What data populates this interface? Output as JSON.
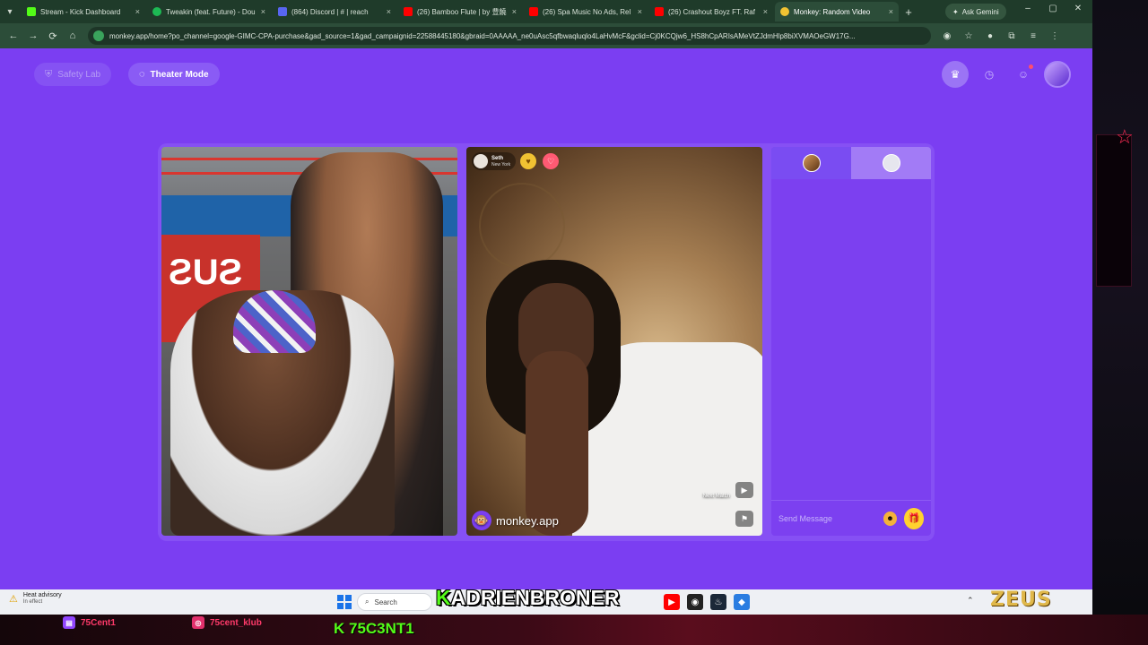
{
  "browser": {
    "tabs": [
      {
        "title": "Stream - Kick Dashboard",
        "color": "#53fc18",
        "active": false
      },
      {
        "title": "Tweakin (feat. Future) - Dou",
        "color": "#1db954",
        "active": false
      },
      {
        "title": "(864) Discord | # | reach",
        "color": "#5865f2",
        "active": false
      },
      {
        "title": "(26) Bamboo Flute | by 豊饒",
        "color": "#ff0000",
        "active": false
      },
      {
        "title": "(26) Spa Music No Ads, Rel",
        "color": "#ff0000",
        "active": false
      },
      {
        "title": "(26) Crashout Boyz FT. Raf",
        "color": "#ff0000",
        "active": false
      },
      {
        "title": "Monkey: Random Video",
        "color": "#f1c232",
        "active": true
      }
    ],
    "new_tab": "+",
    "ask_gemini": "Ask Gemini",
    "url": "monkey.app/home?po_channel=google-GIMC-CPA-purchase&gad_source=1&gad_campaignid=22588445180&gbraid=0AAAAA_ne0uAsc5qfbwaqluqlo4LaHvMcF&gclid=Cj0KCQjw6_HS8hCpARIsAMeVtZJdmHlp8biXVMAOeGW17G..."
  },
  "app": {
    "safety_lab": "Safety Lab",
    "theater_mode": "Theater Mode",
    "remote_user": {
      "name": "Seth",
      "location": "New York"
    },
    "watermark": "monkey.app",
    "next_match": "Next Match",
    "chat_placeholder": "Send Message"
  },
  "taskbar": {
    "weather_title": "Heat advisory",
    "weather_sub": "In effect",
    "search": "Search"
  },
  "overlay": {
    "streamer_k": "K",
    "streamer_rest": "ADRIENBRONER",
    "zeus": "ZEUS",
    "social_1": "75Cent1",
    "social_2": "75cent_klub",
    "kick_code": "K 75C3NT1"
  },
  "colors": {
    "accent": "#7b3ef2",
    "kick_green": "#53fc18"
  }
}
